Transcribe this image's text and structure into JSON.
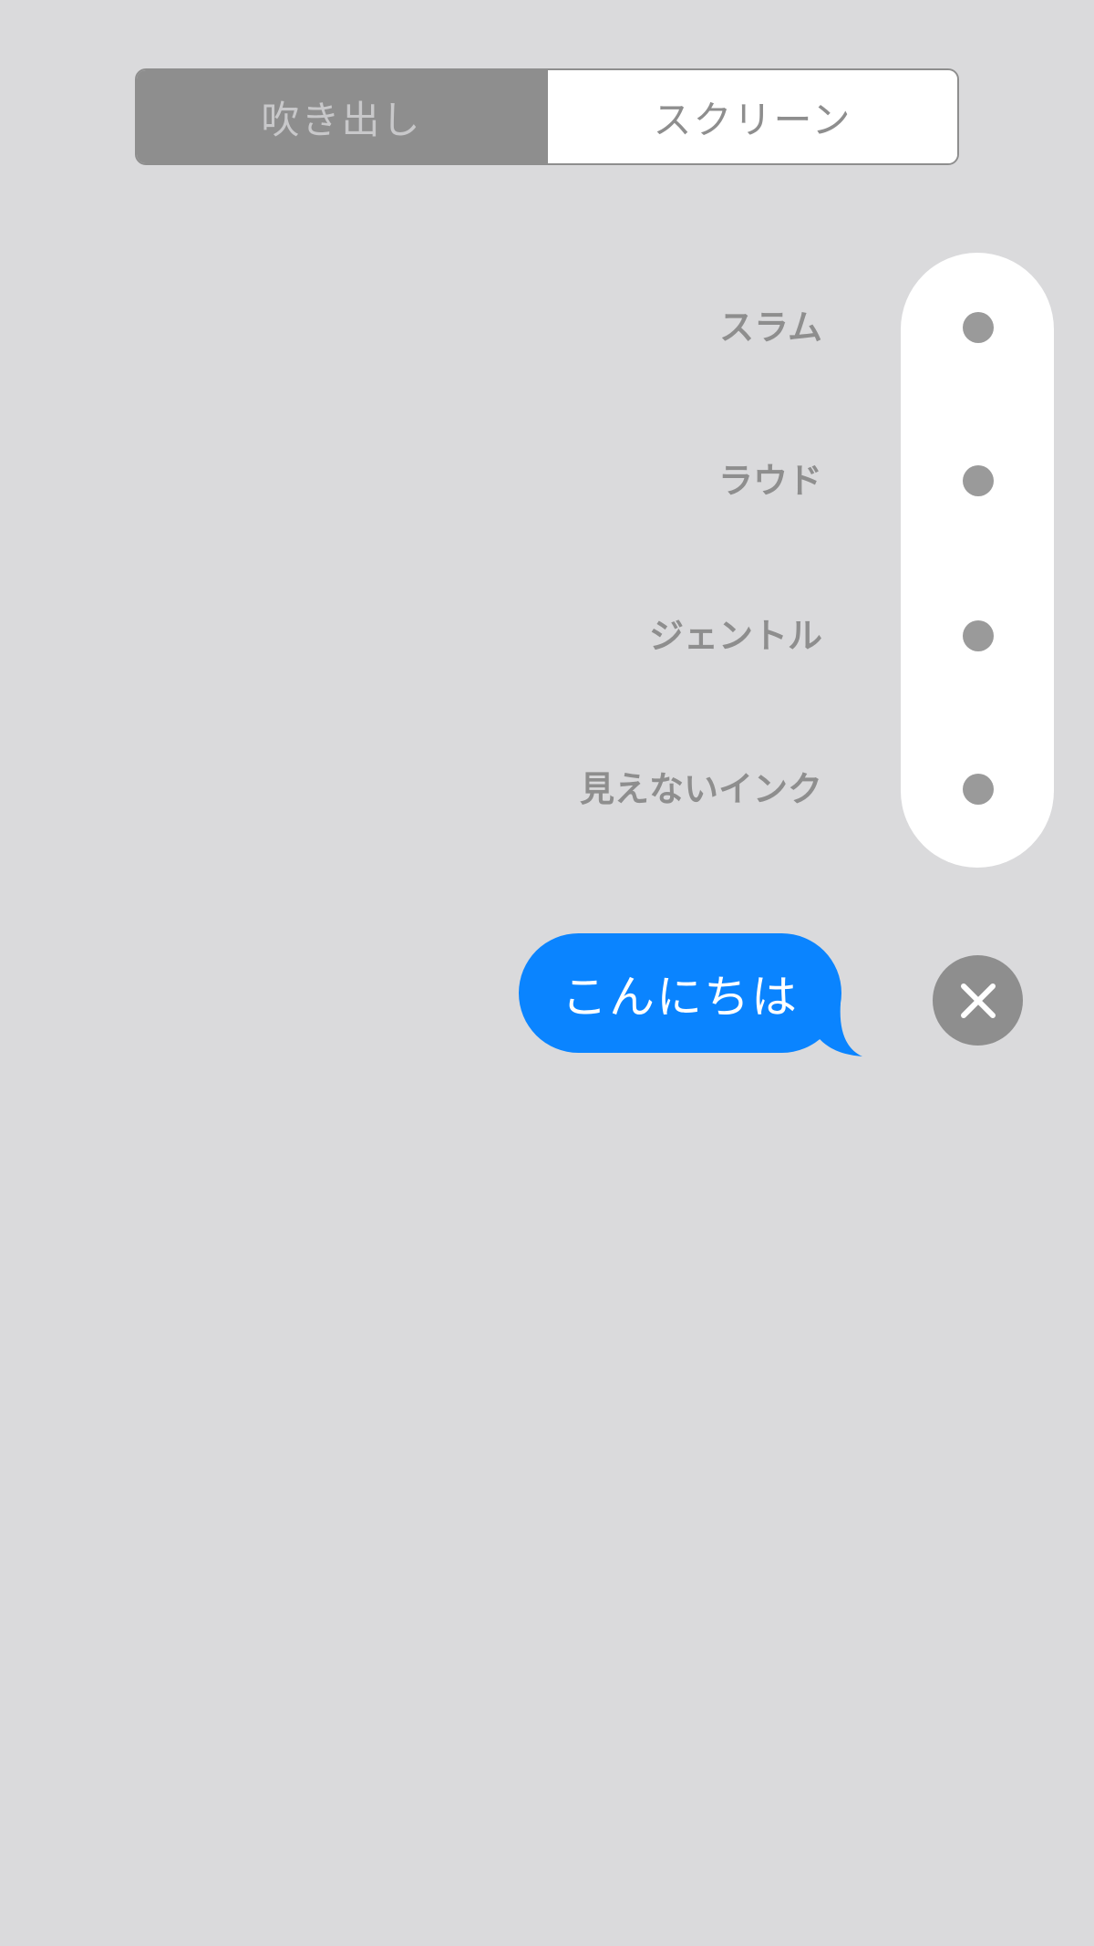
{
  "segmented_control": {
    "bubble_label": "吹き出し",
    "screen_label": "スクリーン",
    "selected": "bubble"
  },
  "effects": [
    {
      "label": "スラム"
    },
    {
      "label": "ラウド"
    },
    {
      "label": "ジェントル"
    },
    {
      "label": "見えないインク"
    }
  ],
  "message": {
    "text": "こんにちは"
  },
  "icons": {
    "cancel": "close-icon",
    "tail": "bubble-tail-icon"
  },
  "colors": {
    "background": "#dadadc",
    "selected_segment": "#8e8e8e",
    "bubble": "#0a84ff",
    "cancel_button": "#8e8e8e"
  }
}
